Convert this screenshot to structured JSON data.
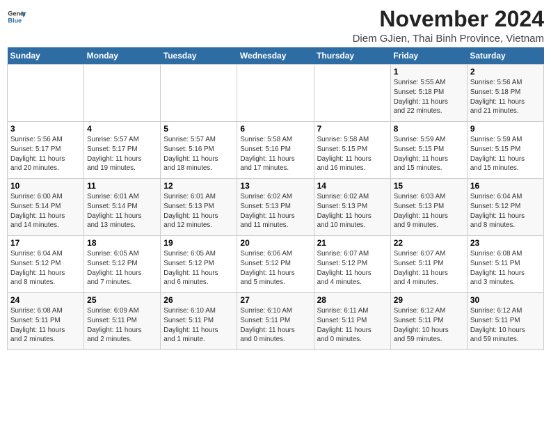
{
  "logo": {
    "line1": "General",
    "line2": "Blue"
  },
  "title": "November 2024",
  "subtitle": "Diem GJien, Thai Binh Province, Vietnam",
  "days_of_week": [
    "Sunday",
    "Monday",
    "Tuesday",
    "Wednesday",
    "Thursday",
    "Friday",
    "Saturday"
  ],
  "weeks": [
    [
      {
        "day": "",
        "info": ""
      },
      {
        "day": "",
        "info": ""
      },
      {
        "day": "",
        "info": ""
      },
      {
        "day": "",
        "info": ""
      },
      {
        "day": "",
        "info": ""
      },
      {
        "day": "1",
        "info": "Sunrise: 5:55 AM\nSunset: 5:18 PM\nDaylight: 11 hours\nand 22 minutes."
      },
      {
        "day": "2",
        "info": "Sunrise: 5:56 AM\nSunset: 5:18 PM\nDaylight: 11 hours\nand 21 minutes."
      }
    ],
    [
      {
        "day": "3",
        "info": "Sunrise: 5:56 AM\nSunset: 5:17 PM\nDaylight: 11 hours\nand 20 minutes."
      },
      {
        "day": "4",
        "info": "Sunrise: 5:57 AM\nSunset: 5:17 PM\nDaylight: 11 hours\nand 19 minutes."
      },
      {
        "day": "5",
        "info": "Sunrise: 5:57 AM\nSunset: 5:16 PM\nDaylight: 11 hours\nand 18 minutes."
      },
      {
        "day": "6",
        "info": "Sunrise: 5:58 AM\nSunset: 5:16 PM\nDaylight: 11 hours\nand 17 minutes."
      },
      {
        "day": "7",
        "info": "Sunrise: 5:58 AM\nSunset: 5:15 PM\nDaylight: 11 hours\nand 16 minutes."
      },
      {
        "day": "8",
        "info": "Sunrise: 5:59 AM\nSunset: 5:15 PM\nDaylight: 11 hours\nand 15 minutes."
      },
      {
        "day": "9",
        "info": "Sunrise: 5:59 AM\nSunset: 5:15 PM\nDaylight: 11 hours\nand 15 minutes."
      }
    ],
    [
      {
        "day": "10",
        "info": "Sunrise: 6:00 AM\nSunset: 5:14 PM\nDaylight: 11 hours\nand 14 minutes."
      },
      {
        "day": "11",
        "info": "Sunrise: 6:01 AM\nSunset: 5:14 PM\nDaylight: 11 hours\nand 13 minutes."
      },
      {
        "day": "12",
        "info": "Sunrise: 6:01 AM\nSunset: 5:13 PM\nDaylight: 11 hours\nand 12 minutes."
      },
      {
        "day": "13",
        "info": "Sunrise: 6:02 AM\nSunset: 5:13 PM\nDaylight: 11 hours\nand 11 minutes."
      },
      {
        "day": "14",
        "info": "Sunrise: 6:02 AM\nSunset: 5:13 PM\nDaylight: 11 hours\nand 10 minutes."
      },
      {
        "day": "15",
        "info": "Sunrise: 6:03 AM\nSunset: 5:13 PM\nDaylight: 11 hours\nand 9 minutes."
      },
      {
        "day": "16",
        "info": "Sunrise: 6:04 AM\nSunset: 5:12 PM\nDaylight: 11 hours\nand 8 minutes."
      }
    ],
    [
      {
        "day": "17",
        "info": "Sunrise: 6:04 AM\nSunset: 5:12 PM\nDaylight: 11 hours\nand 8 minutes."
      },
      {
        "day": "18",
        "info": "Sunrise: 6:05 AM\nSunset: 5:12 PM\nDaylight: 11 hours\nand 7 minutes."
      },
      {
        "day": "19",
        "info": "Sunrise: 6:05 AM\nSunset: 5:12 PM\nDaylight: 11 hours\nand 6 minutes."
      },
      {
        "day": "20",
        "info": "Sunrise: 6:06 AM\nSunset: 5:12 PM\nDaylight: 11 hours\nand 5 minutes."
      },
      {
        "day": "21",
        "info": "Sunrise: 6:07 AM\nSunset: 5:12 PM\nDaylight: 11 hours\nand 4 minutes."
      },
      {
        "day": "22",
        "info": "Sunrise: 6:07 AM\nSunset: 5:11 PM\nDaylight: 11 hours\nand 4 minutes."
      },
      {
        "day": "23",
        "info": "Sunrise: 6:08 AM\nSunset: 5:11 PM\nDaylight: 11 hours\nand 3 minutes."
      }
    ],
    [
      {
        "day": "24",
        "info": "Sunrise: 6:08 AM\nSunset: 5:11 PM\nDaylight: 11 hours\nand 2 minutes."
      },
      {
        "day": "25",
        "info": "Sunrise: 6:09 AM\nSunset: 5:11 PM\nDaylight: 11 hours\nand 2 minutes."
      },
      {
        "day": "26",
        "info": "Sunrise: 6:10 AM\nSunset: 5:11 PM\nDaylight: 11 hours\nand 1 minute."
      },
      {
        "day": "27",
        "info": "Sunrise: 6:10 AM\nSunset: 5:11 PM\nDaylight: 11 hours\nand 0 minutes."
      },
      {
        "day": "28",
        "info": "Sunrise: 6:11 AM\nSunset: 5:11 PM\nDaylight: 11 hours\nand 0 minutes."
      },
      {
        "day": "29",
        "info": "Sunrise: 6:12 AM\nSunset: 5:11 PM\nDaylight: 10 hours\nand 59 minutes."
      },
      {
        "day": "30",
        "info": "Sunrise: 6:12 AM\nSunset: 5:11 PM\nDaylight: 10 hours\nand 59 minutes."
      }
    ]
  ]
}
